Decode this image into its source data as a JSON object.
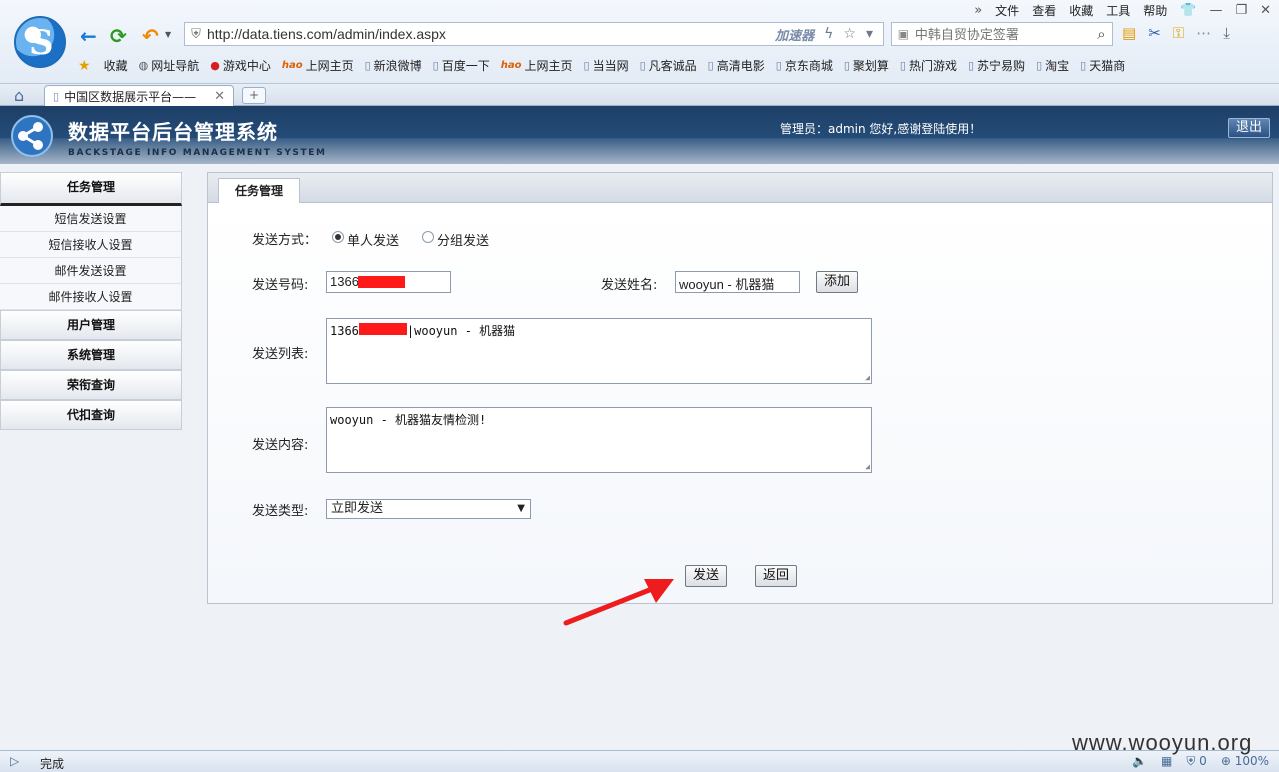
{
  "browser": {
    "menu": [
      "文件",
      "查看",
      "收藏",
      "工具",
      "帮助"
    ],
    "url": "http://data.tiens.com/admin/index.aspx",
    "accelerator_label": "加速器",
    "search_placeholder": "中韩自贸协定签署",
    "favorites": [
      {
        "label": "收藏",
        "icon": "star"
      },
      {
        "label": "网址导航",
        "icon": "globe"
      },
      {
        "label": "游戏中心",
        "icon": "game"
      },
      {
        "label": "上网主页",
        "icon": "hao"
      },
      {
        "label": "新浪微博",
        "icon": "page"
      },
      {
        "label": "百度一下",
        "icon": "page"
      },
      {
        "label": "上网主页",
        "icon": "hao"
      },
      {
        "label": "当当网",
        "icon": "page"
      },
      {
        "label": "凡客诚品",
        "icon": "page"
      },
      {
        "label": "高清电影",
        "icon": "page"
      },
      {
        "label": "京东商城",
        "icon": "page"
      },
      {
        "label": "聚划算",
        "icon": "page"
      },
      {
        "label": "热门游戏",
        "icon": "page"
      },
      {
        "label": "苏宁易购",
        "icon": "page"
      },
      {
        "label": "淘宝",
        "icon": "page"
      },
      {
        "label": "天猫商",
        "icon": "page"
      }
    ],
    "hao_text": "hao",
    "tab_title": "中国区数据展示平台——",
    "status_text": "完成",
    "zoom": "100%",
    "status_count": "0"
  },
  "app": {
    "title": "数据平台后台管理系统",
    "subtitle": "BACKSTAGE INFO MANAGEMENT SYSTEM",
    "greeting": "管理员：admin 您好,感谢登陆使用！",
    "logout_label": "退出"
  },
  "sidebar": {
    "groups": [
      {
        "label": "任务管理",
        "active": true,
        "items": [
          "短信发送设置",
          "短信接收人设置",
          "邮件发送设置",
          "邮件接收人设置"
        ]
      },
      {
        "label": "用户管理",
        "active": false,
        "items": []
      },
      {
        "label": "系统管理",
        "active": false,
        "items": []
      },
      {
        "label": "荣衔查询",
        "active": false,
        "items": []
      },
      {
        "label": "代扣查询",
        "active": false,
        "items": []
      }
    ]
  },
  "panel": {
    "tab_label": "任务管理",
    "form": {
      "send_method_label": "发送方式：",
      "radio_single": "单人发送",
      "radio_group": "分组发送",
      "selected_method": "single",
      "number_label": "发送号码:",
      "number_value": "1366",
      "name_label": "发送姓名:",
      "name_value": "wooyun - 机器猫",
      "add_button": "添加",
      "list_label": "发送列表:",
      "list_value_prefix": "1366",
      "list_value_suffix": "|wooyun - 机器猫",
      "content_label": "发送内容:",
      "content_value": "wooyun - 机器猫友情检测!",
      "type_label": "发送类型:",
      "type_value": "立即发送",
      "send_button": "发送",
      "back_button": "返回"
    }
  },
  "watermark": "www.wooyun.org",
  "colors": {
    "header_dark": "#1d3f66",
    "redaction": "#ff1a1a",
    "arrow": "#ee1c1c"
  }
}
